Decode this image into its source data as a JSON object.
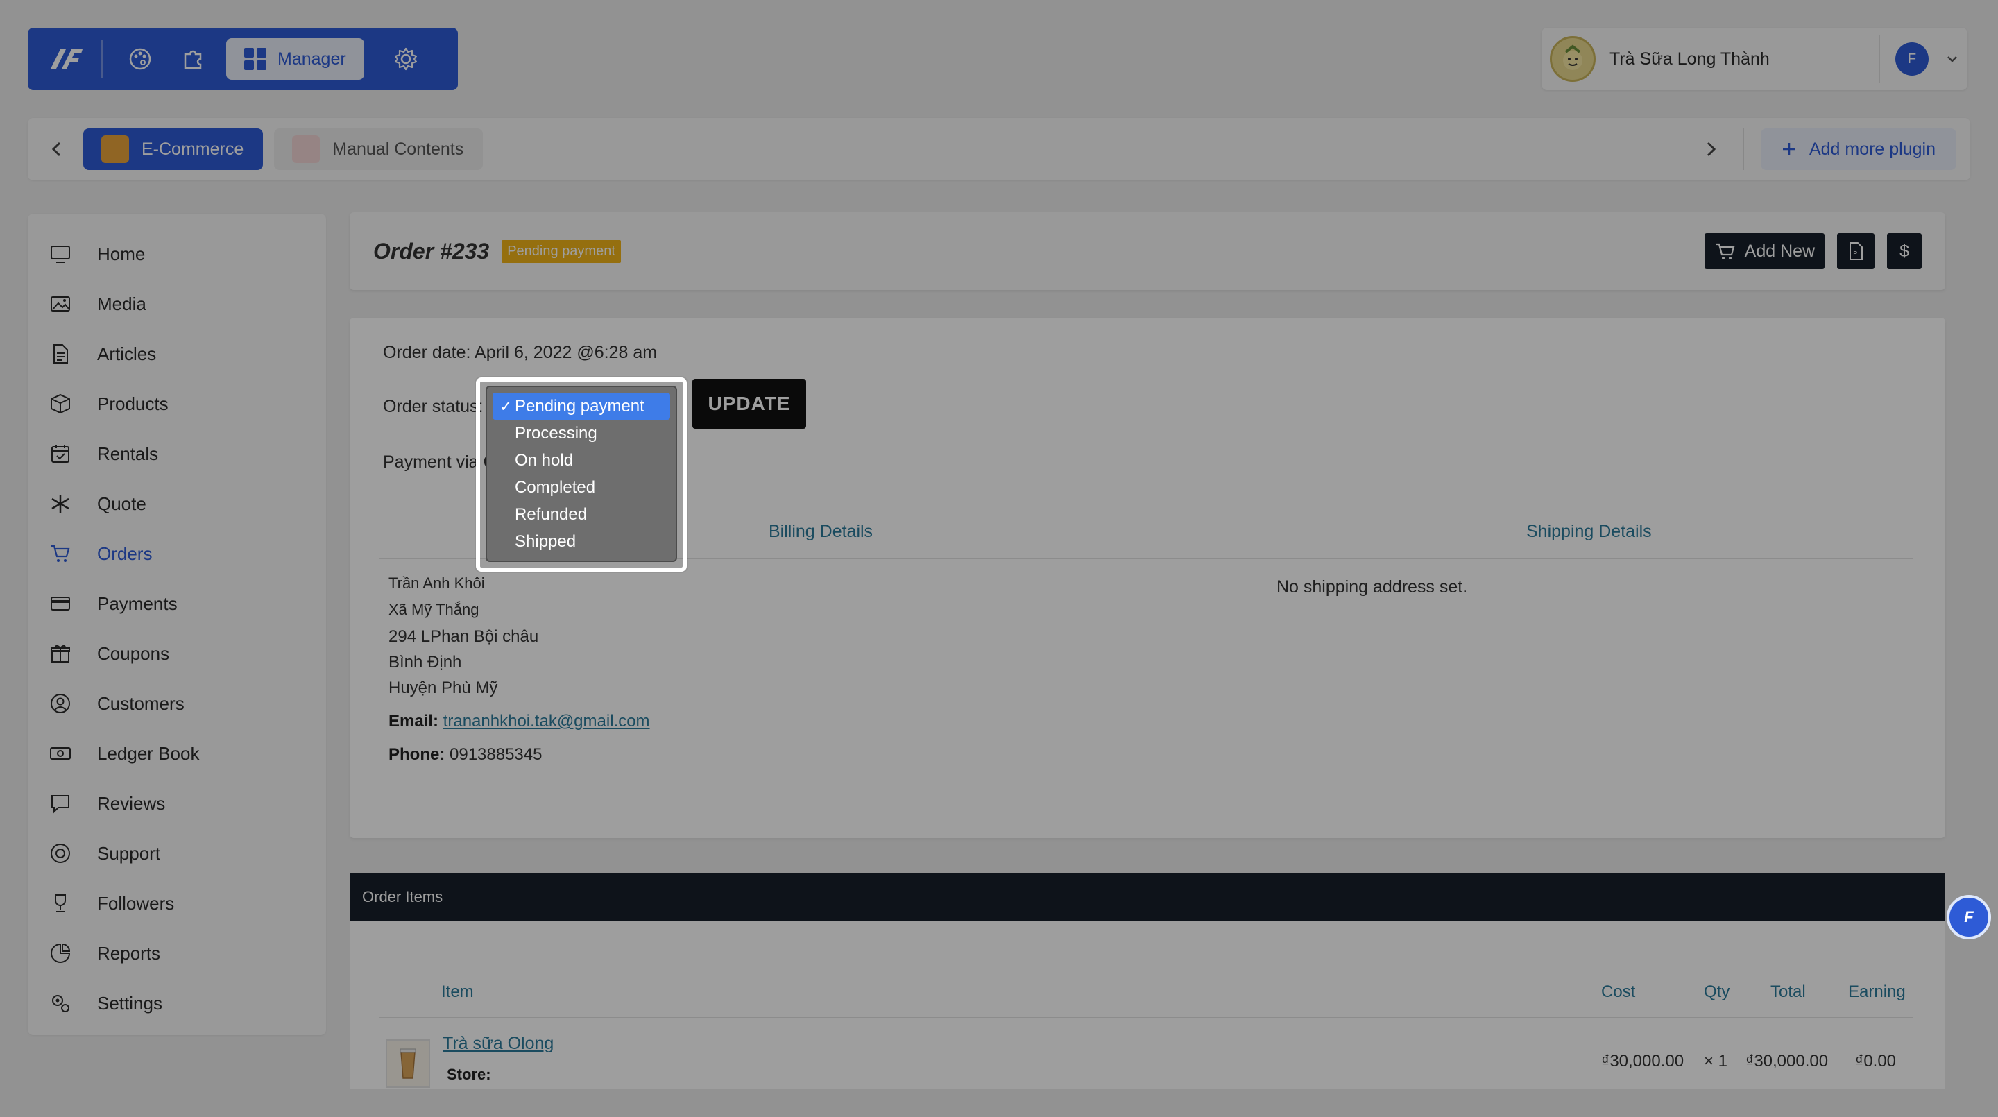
{
  "topbar": {
    "manager_label": "Manager"
  },
  "user": {
    "name": "Trà Sữa Long Thành"
  },
  "plugins": {
    "active_label": "E-Commerce",
    "inactive_label": "Manual Contents",
    "add_label": "Add more plugin"
  },
  "sidebar": {
    "items": [
      {
        "label": "Home",
        "icon": "monitor-icon"
      },
      {
        "label": "Media",
        "icon": "image-icon"
      },
      {
        "label": "Articles",
        "icon": "document-icon"
      },
      {
        "label": "Products",
        "icon": "box-icon"
      },
      {
        "label": "Rentals",
        "icon": "calendar-check-icon"
      },
      {
        "label": "Quote",
        "icon": "snowflake-icon"
      },
      {
        "label": "Orders",
        "icon": "cart-icon"
      },
      {
        "label": "Payments",
        "icon": "credit-card-icon"
      },
      {
        "label": "Coupons",
        "icon": "gift-icon"
      },
      {
        "label": "Customers",
        "icon": "user-circle-icon"
      },
      {
        "label": "Ledger Book",
        "icon": "money-icon"
      },
      {
        "label": "Reviews",
        "icon": "chat-icon"
      },
      {
        "label": "Support",
        "icon": "lifebuoy-icon"
      },
      {
        "label": "Followers",
        "icon": "trophy-icon"
      },
      {
        "label": "Reports",
        "icon": "pie-chart-icon"
      },
      {
        "label": "Settings",
        "icon": "gears-icon"
      }
    ],
    "active_index": 6
  },
  "order": {
    "title": "Order #233",
    "badge": "Pending payment",
    "add_new_label": "Add New",
    "pdf_label": "P",
    "dollar_label": "$",
    "date_line": "Order date: April 6, 2022 @6:28 am",
    "status_label": "Order status:",
    "payment_label": "Payment via C",
    "update_label": "UPDATE",
    "status_options": [
      "Pending payment",
      "Processing",
      "On hold",
      "Completed",
      "Refunded",
      "Shipped"
    ],
    "selected_status": "Pending payment",
    "billing_header": "Billing Details",
    "shipping_header": "Shipping Details",
    "billing": {
      "name": "Trần Anh Khôi",
      "line2": "Xã Mỹ Thắng",
      "line3": "294 LPhan Bội châu",
      "line4": "Bình Định",
      "line5": "Huyện Phù Mỹ",
      "email_label": "Email:",
      "email": "trananhkhoi.tak@gmail.com",
      "phone_label": "Phone:",
      "phone": "0913885345"
    },
    "shipping_empty": "No shipping address set."
  },
  "items": {
    "section_title": "Order Items",
    "columns": {
      "item": "Item",
      "cost": "Cost",
      "qty": "Qty",
      "total": "Total",
      "earning": "Earning"
    },
    "rows": [
      {
        "name": "Trà sữa Olong",
        "store_label": "Store:",
        "cost": "₫30,000.00",
        "qty": "× 1",
        "total": "₫30,000.00",
        "earning": "₫0.00"
      }
    ]
  },
  "colors": {
    "brand": "#2e5bd6",
    "dark": "#17202b",
    "badge": "#f0b419",
    "link": "#2b7a9a"
  }
}
